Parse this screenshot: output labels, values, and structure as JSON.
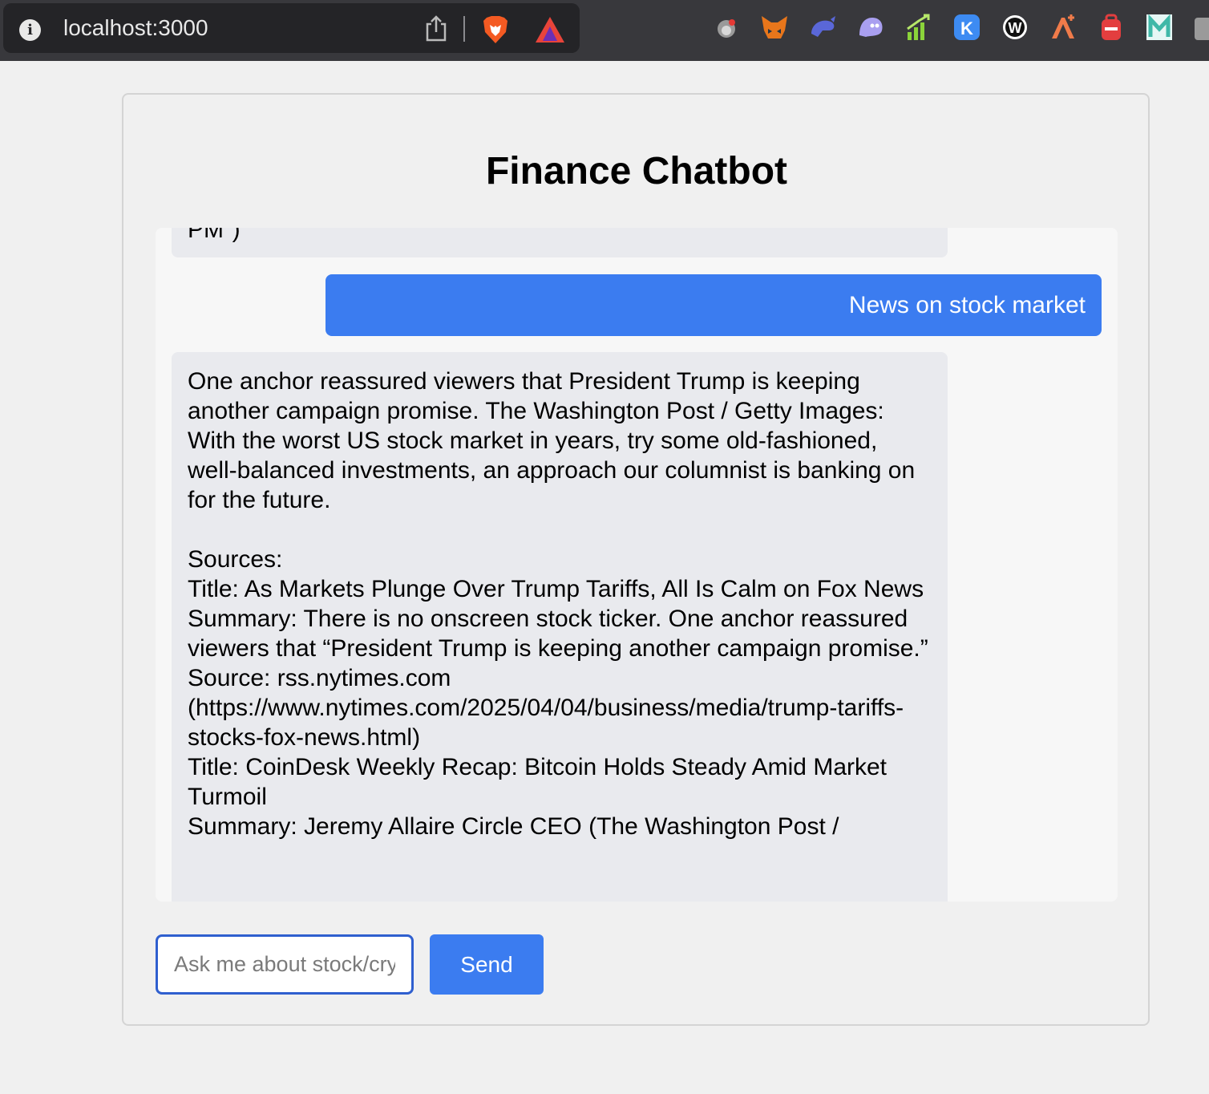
{
  "browser": {
    "url": "localhost:3000",
    "toolbar_icons": [
      "info-icon",
      "share-icon",
      "brave-shields-icon",
      "brave-rewards-icon"
    ],
    "extensions": [
      "robot-extension-icon",
      "metamask-fox-icon",
      "phantom-whale-icon",
      "ghost-wallet-icon",
      "stock-chart-icon",
      "k-extension-icon",
      "w-extension-icon",
      "anchor-extension-icon",
      "backpack-extension-icon",
      "m-extension-icon",
      "puzzle-icon"
    ]
  },
  "app": {
    "title": "Finance Chatbot",
    "messages": {
      "partial_bot": "PM\")",
      "user": "News on stock market",
      "bot_intro": "One anchor reassured viewers that President Trump is keeping another campaign promise. The Washington Post / Getty Images: With the worst US stock market in years, try some old-fashioned, well-balanced investments, an approach our columnist is banking on for the future.",
      "sources_label": "Sources:",
      "source1_title": "Title: As Markets Plunge Over Trump Tariffs, All Is Calm on Fox News",
      "source1_summary": "Summary: There is no onscreen stock ticker. One anchor reassured viewers that “President Trump is keeping another campaign promise.”",
      "source1_source": "Source: rss.nytimes.com (https://www.nytimes.com/2025/04/04/business/media/trump-tariffs-stocks-fox-news.html)",
      "source2_title": "Title: CoinDesk Weekly Recap: Bitcoin Holds Steady Amid Market Turmoil",
      "source2_summary": "Summary: Jeremy Allaire Circle CEO (The Washington Post /"
    },
    "input": {
      "placeholder": "Ask me about stock/crypto"
    },
    "send_label": "Send"
  }
}
